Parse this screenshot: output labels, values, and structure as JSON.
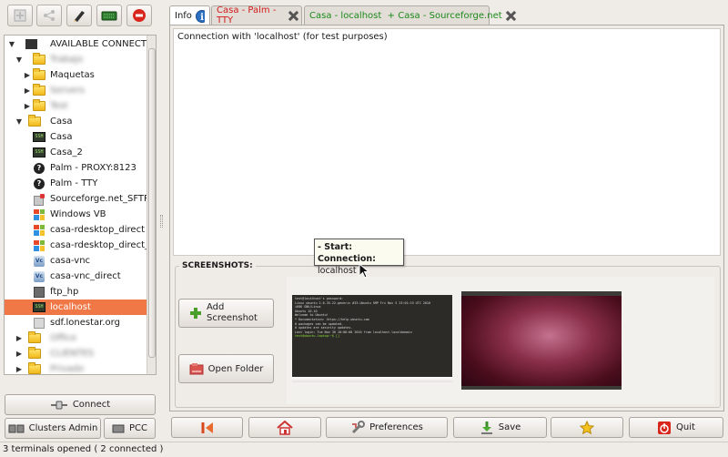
{
  "tree": {
    "root_label": "AVAILABLE CONNECTIONS",
    "items": [
      {
        "label": "Trabajo",
        "type": "folder",
        "blurred": true
      },
      {
        "label": "Maquetas",
        "type": "folder"
      },
      {
        "label": "Servers",
        "type": "folder",
        "blurred": true
      },
      {
        "label": "Test",
        "type": "folder",
        "blurred": true
      },
      {
        "label": "Casa",
        "type": "folder"
      },
      {
        "label": "Casa",
        "type": "ssh"
      },
      {
        "label": "Casa_2",
        "type": "ssh"
      },
      {
        "label": "Palm - PROXY:8123",
        "type": "question"
      },
      {
        "label": "Palm - TTY",
        "type": "question"
      },
      {
        "label": "Sourceforge.net_SFTP",
        "type": "sftp"
      },
      {
        "label": "Windows VB",
        "type": "windows"
      },
      {
        "label": "casa-rdesktop_direct",
        "type": "windows"
      },
      {
        "label": "casa-rdesktop_direct_19",
        "type": "windows"
      },
      {
        "label": "casa-vnc",
        "type": "vnc"
      },
      {
        "label": "casa-vnc_direct",
        "type": "vnc"
      },
      {
        "label": "ftp_hp",
        "type": "ftp"
      },
      {
        "label": "localhost",
        "type": "ssh",
        "selected": true
      },
      {
        "label": "sdf.lonestar.org",
        "type": "computer"
      },
      {
        "label": "Office",
        "type": "folder",
        "blurred": true
      },
      {
        "label": "CLIENTES",
        "type": "folder",
        "blurred": true
      },
      {
        "label": "Privado",
        "type": "folder",
        "blurred": true
      }
    ]
  },
  "buttons": {
    "connect": "Connect",
    "clusters_admin": "Clusters Admin",
    "pcc": "PCC",
    "add_screenshot": "Add Screenshot",
    "open_folder": "Open Folder",
    "preferences": "Preferences",
    "save": "Save",
    "quit": "Quit"
  },
  "tabs": [
    {
      "label": "Info",
      "color": "#222222"
    },
    {
      "label": "Casa - Palm - TTY",
      "color": "#d21a1a"
    },
    {
      "label": "Casa - localhost  + Casa - Sourceforge.net",
      "color": "#1a8a1a"
    }
  ],
  "info_text": "Connection with 'localhost' (for test purposes)",
  "screenshots_label": "SCREENSHOTS:",
  "tooltip": {
    "start": "- Start:",
    "conn_label": "Connection:",
    "conn_value": "localhost"
  },
  "terminal_lines": [
    "test@localhost's password:",
    "Linux ubuntu 2.6.35-22-generic #33-Ubuntu SMP Fri Nov 5 23:01:19 UTC 2010",
    "i686 GNU/Linux",
    "Ubuntu 10.10",
    "",
    "Welcome to Ubuntu!",
    " * Documentation:  https://help.ubuntu.com",
    "",
    "0 packages can be updated.",
    "0 updates are security updates.",
    "",
    "Last login: Tue Nov 30 10:08:00 2010 from localhost.localdomain",
    "test@ubuntu-laptop:~$ []"
  ],
  "status_bar": "3 terminals opened ( 2 connected )"
}
